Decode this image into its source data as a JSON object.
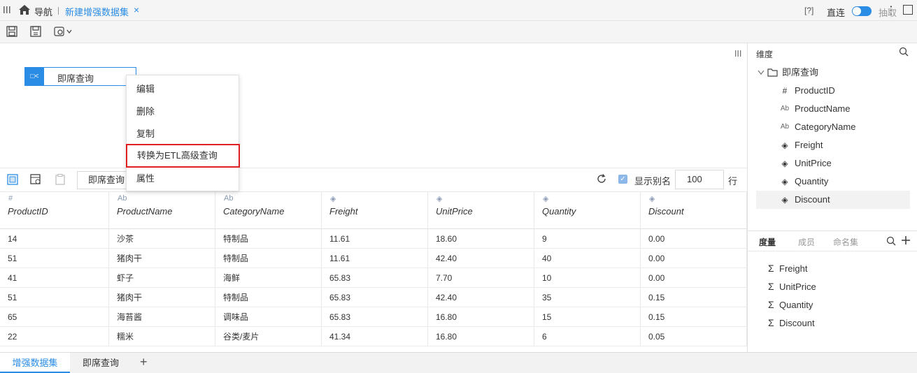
{
  "titlebar": {
    "nav_label": "导航",
    "active_tab": "新建增强数据集",
    "close_glyph": "×",
    "more_glyph": "⋮"
  },
  "toolbar": {
    "help": "[?]",
    "direct_label": "直连",
    "extract_label": "抽取",
    "toggle_on": true
  },
  "canvas": {
    "node_label": "即席查询",
    "node_icon": "□<"
  },
  "context_menu": {
    "items": [
      "编辑",
      "删除",
      "复制",
      "转换为ETL高级查询",
      "属性"
    ],
    "highlighted_index": 3
  },
  "grid_toolbar": {
    "query_name": "即席查询",
    "show_alias_label": "显示别名",
    "show_alias_checked": true,
    "rows_value": "100",
    "rows_unit": "行"
  },
  "table": {
    "columns": [
      {
        "type": "#",
        "name": "ProductID"
      },
      {
        "type": "Ab",
        "name": "ProductName"
      },
      {
        "type": "Ab",
        "name": "CategoryName"
      },
      {
        "type": "measure",
        "name": "Freight"
      },
      {
        "type": "measure",
        "name": "UnitPrice"
      },
      {
        "type": "measure",
        "name": "Quantity"
      },
      {
        "type": "measure",
        "name": "Discount"
      }
    ],
    "rows": [
      [
        "14",
        "沙茶",
        "特制品",
        "11.61",
        "18.60",
        "9",
        "0.00"
      ],
      [
        "51",
        "猪肉干",
        "特制品",
        "11.61",
        "42.40",
        "40",
        "0.00"
      ],
      [
        "41",
        "虾子",
        "海鲜",
        "65.83",
        "7.70",
        "10",
        "0.00"
      ],
      [
        "51",
        "猪肉干",
        "特制品",
        "65.83",
        "42.40",
        "35",
        "0.15"
      ],
      [
        "65",
        "海苔酱",
        "调味品",
        "65.83",
        "16.80",
        "15",
        "0.15"
      ],
      [
        "22",
        "糯米",
        "谷类/麦片",
        "41.34",
        "16.80",
        "6",
        "0.05"
      ]
    ]
  },
  "dimensions": {
    "title": "维度",
    "folder": "即席查询",
    "fields": [
      {
        "icon": "#",
        "name": "ProductID"
      },
      {
        "icon": "Ab",
        "name": "ProductName"
      },
      {
        "icon": "Ab",
        "name": "CategoryName"
      },
      {
        "icon": "measure",
        "name": "Freight"
      },
      {
        "icon": "measure",
        "name": "UnitPrice"
      },
      {
        "icon": "measure",
        "name": "Quantity"
      },
      {
        "icon": "measure",
        "name": "Discount"
      }
    ],
    "selected_index": 6
  },
  "measures": {
    "tabs": [
      "度量",
      "成员",
      "命名集"
    ],
    "active_tab": 0,
    "items": [
      "Freight",
      "UnitPrice",
      "Quantity",
      "Discount"
    ]
  },
  "bottom_tabs": {
    "tab1": "增强数据集",
    "tab2": "即席查询",
    "add": "+"
  }
}
